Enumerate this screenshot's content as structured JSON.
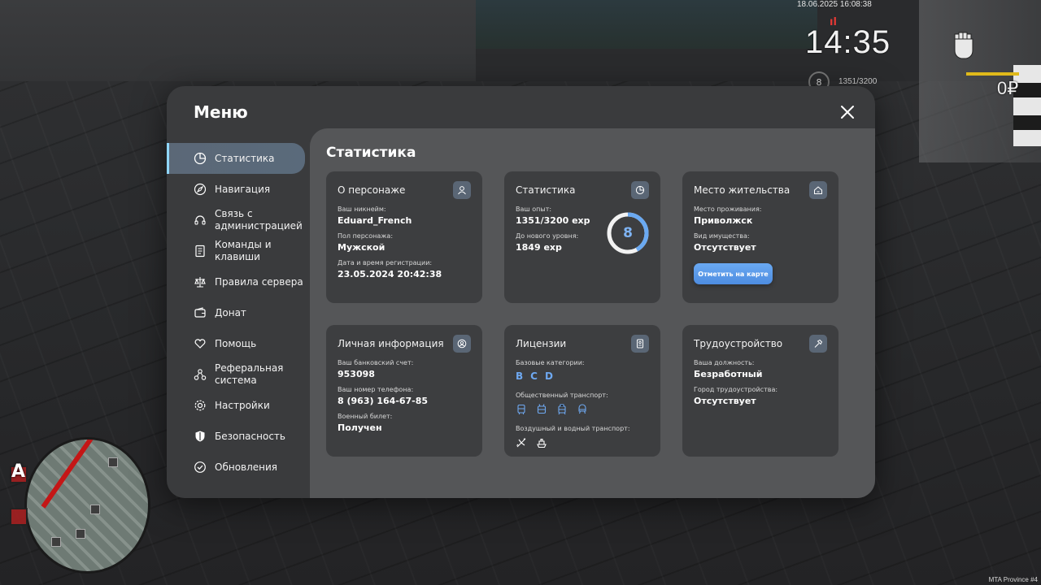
{
  "hud": {
    "datetime": "18.06.2025 16:08:38",
    "time": "14:35",
    "level": "8",
    "exp": "1351/3200",
    "money": "0₽",
    "server": "MTA Province #4"
  },
  "menu": {
    "title": "Меню",
    "sidebar": [
      {
        "label": "Статистика",
        "icon": "pie-chart-icon",
        "active": true
      },
      {
        "label": "Навигация",
        "icon": "compass-icon"
      },
      {
        "label": "Связь с администрацией",
        "icon": "headset-icon"
      },
      {
        "label": "Команды и клавиши",
        "icon": "document-icon"
      },
      {
        "label": "Правила сервера",
        "icon": "scales-icon"
      },
      {
        "label": "Донат",
        "icon": "wallet-icon"
      },
      {
        "label": "Помощь",
        "icon": "heart-hand-icon"
      },
      {
        "label": "Реферальная система",
        "icon": "network-icon"
      },
      {
        "label": "Настройки",
        "icon": "gear-icon"
      },
      {
        "label": "Безопасность",
        "icon": "shield-icon"
      },
      {
        "label": "Обновления",
        "icon": "check-circle-icon"
      }
    ]
  },
  "stats": {
    "title": "Статистика",
    "character": {
      "title": "О персонаже",
      "nickname_label": "Ваш никнейм:",
      "nickname": "Eduard_French",
      "gender_label": "Пол персонажа:",
      "gender": "Мужской",
      "reg_label": "Дата и время регистрации:",
      "reg": "23.05.2024 20:42:38"
    },
    "statistics": {
      "title": "Статистика",
      "exp_label": "Ваш опыт:",
      "exp": "1351/3200 exp",
      "next_label": "До нового уровня:",
      "next": "1849 exp",
      "level": "8",
      "progress": 0.42
    },
    "residence": {
      "title": "Место жительства",
      "place_label": "Место проживания:",
      "place": "Приволжск",
      "property_label": "Вид имущества:",
      "property": "Отсутствует",
      "button": "Отметить на карте"
    },
    "personal": {
      "title": "Личная информация",
      "bank_label": "Ваш банковский счет:",
      "bank": "953098",
      "phone_label": "Ваш номер телефона:",
      "phone": "8 (963) 164-67-85",
      "military_label": "Военный билет:",
      "military": "Получен"
    },
    "licenses": {
      "title": "Лицензии",
      "base_label": "Базовые категории:",
      "categories": [
        "B",
        "C",
        "D"
      ],
      "public_label": "Общественный транспорт:",
      "air_label": "Воздушный и водный транспорт:"
    },
    "employment": {
      "title": "Трудоустройство",
      "position_label": "Ваша должность:",
      "position": "Безработный",
      "city_label": "Город трудоустройства:",
      "city": "Отсутствует"
    }
  }
}
